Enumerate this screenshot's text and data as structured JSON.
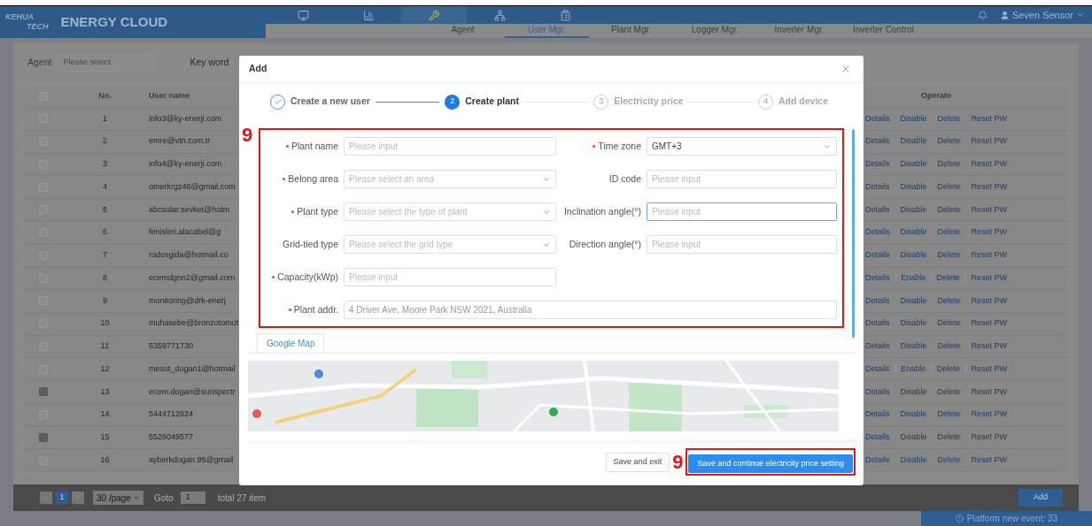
{
  "header": {
    "logo_top": "KEHUA",
    "logo_bottom": "TECH",
    "brand": "ENERGY CLOUD",
    "modules": [
      {
        "kind": "monitor",
        "selected": false
      },
      {
        "kind": "chart",
        "selected": false
      },
      {
        "kind": "tools",
        "selected": true
      },
      {
        "kind": "sitemap",
        "selected": false
      },
      {
        "kind": "clipboard",
        "selected": false
      }
    ],
    "tabs": [
      {
        "label": "Agent",
        "selected": false
      },
      {
        "label": "User Mgr.",
        "selected": true
      },
      {
        "label": "Plant Mgr.",
        "selected": false
      },
      {
        "label": "Logger Mgr.",
        "selected": false
      },
      {
        "label": "Inverter Mgr.",
        "selected": false
      },
      {
        "label": "Inverter Control",
        "selected": false
      }
    ],
    "user": "Seven Sensor"
  },
  "filters": {
    "agent_label": "Agent",
    "agent_placeholder": "Please select",
    "keyword_label": "Key word"
  },
  "table": {
    "columns": [
      "No.",
      "User name",
      "Operate"
    ],
    "all_checked": false,
    "rows": [
      {
        "no": "1",
        "user": "info3@ky-enerji.com",
        "actions": [
          "Details",
          "Disable",
          "Delete",
          "Reset PW"
        ],
        "disabled": false
      },
      {
        "no": "2",
        "user": "emre@vtn.com.tr",
        "actions": [
          "Details",
          "Disable",
          "Delete",
          "Reset PW"
        ],
        "disabled": false
      },
      {
        "no": "3",
        "user": "info4@ky-enerji.com",
        "actions": [
          "Details",
          "Disable",
          "Delete",
          "Reset PW"
        ],
        "disabled": false
      },
      {
        "no": "4",
        "user": "omerkrgz46@gmail.com",
        "actions": [
          "Details",
          "Disable",
          "Delete",
          "Reset PW"
        ],
        "disabled": false
      },
      {
        "no": "5",
        "user": "abcsolar.sevket@hotm",
        "actions": [
          "Details",
          "Disable",
          "Delete",
          "Reset PW"
        ],
        "disabled": false
      },
      {
        "no": "6",
        "user": "fenisleri.alacabel@g",
        "actions": [
          "Details",
          "Disable",
          "Delete",
          "Reset PW"
        ],
        "disabled": false
      },
      {
        "no": "7",
        "user": "rodosgida@hotmail.co",
        "actions": [
          "Details",
          "Disable",
          "Delete",
          "Reset PW"
        ],
        "disabled": false
      },
      {
        "no": "8",
        "user": "ecemdgnn2@gmail.com",
        "actions": [
          "Details",
          "Enable",
          "Delete",
          "Reset PW"
        ],
        "disabled": false
      },
      {
        "no": "9",
        "user": "monitoring@drk-enerj",
        "actions": [
          "Details",
          "Disable",
          "Delete",
          "Reset PW"
        ],
        "disabled": false
      },
      {
        "no": "10",
        "user": "muhasebe@bronzotomot",
        "actions": [
          "Details",
          "Disable",
          "Delete",
          "Reset PW"
        ],
        "disabled": false
      },
      {
        "no": "11",
        "user": "5359771730",
        "actions": [
          "Details",
          "Disable",
          "Delete",
          "Reset PW"
        ],
        "disabled": false
      },
      {
        "no": "12",
        "user": "mesut_dogan1@hotmail",
        "actions": [
          "Details",
          "Enable",
          "Delete",
          "Reset PW"
        ],
        "disabled": false
      },
      {
        "no": "13",
        "user": "ecem.dogan@sunspectr",
        "actions": [
          "Details",
          "Disable",
          "Delete",
          "Reset PW"
        ],
        "disabled": true
      },
      {
        "no": "14",
        "user": "5444712924",
        "actions": [
          "Details",
          "Disable",
          "Delete",
          "Reset PW"
        ],
        "disabled": false
      },
      {
        "no": "15",
        "user": "5528049577",
        "actions": [
          "Details",
          "Disable",
          "Delete",
          "Reset PW"
        ],
        "disabled": true
      },
      {
        "no": "16",
        "user": "ayberkdogan.95@gmail",
        "actions": [
          "Details",
          "Disable",
          "Delete",
          "Reset PW"
        ],
        "disabled": false
      }
    ]
  },
  "pagination": {
    "pages": [
      {
        "label": "1",
        "selected": true
      }
    ],
    "page_size": "30 /page",
    "goto_label": "Goto",
    "goto_value": "1",
    "total": "total 27 item"
  },
  "add_button": "Add",
  "event_banner": "Platform new event: 33",
  "modal": {
    "title": "Add",
    "steps": [
      {
        "label": "Create a new user",
        "completed": true,
        "selected": false
      },
      {
        "number": "2",
        "label": "Create plant",
        "completed": false,
        "selected": true
      },
      {
        "number": "3",
        "label": "Electricity price",
        "completed": false,
        "selected": false
      },
      {
        "number": "4",
        "label": "Add device",
        "completed": false,
        "selected": false
      }
    ],
    "fields": [
      {
        "label": "Plant name",
        "required": true,
        "kind": "input",
        "placeholder": "Please input",
        "focused": false
      },
      {
        "label": "Time zone",
        "required": true,
        "kind": "select",
        "value": "GMT+3",
        "focused": false
      },
      {
        "label": "Belong area",
        "required": true,
        "kind": "select",
        "placeholder": "Please select an area",
        "focused": false
      },
      {
        "label": "ID code",
        "required": false,
        "kind": "input",
        "placeholder": "Please input",
        "focused": false
      },
      {
        "label": "Plant type",
        "required": true,
        "kind": "select",
        "placeholder": "Please select the type of plant",
        "focused": false
      },
      {
        "label": "Inclination angle(°)",
        "required": false,
        "kind": "input",
        "placeholder": "Please input",
        "focused": true
      },
      {
        "label": "Grid-tied type",
        "required": false,
        "kind": "select",
        "placeholder": "Please select the grid type",
        "focused": false
      },
      {
        "label": "Direction angle(°)",
        "required": false,
        "kind": "input",
        "placeholder": "Please input",
        "focused": false
      },
      {
        "label": "Capacity(kWp)",
        "required": true,
        "kind": "input",
        "placeholder": "Please input",
        "focused": false
      },
      {
        "label": "Plant addr.",
        "required": true,
        "kind": "wide",
        "value": "4 Driver Ave, Moore Park NSW 2021, Australia",
        "focused": false
      }
    ],
    "map_tab": "Google Map",
    "buttons": [
      {
        "label": "Save and exit",
        "primary": false
      },
      {
        "label": "Save and continue electricity price setting",
        "primary": true
      }
    ],
    "annotations": [
      {
        "label": "9"
      },
      {
        "label": "9"
      }
    ]
  }
}
